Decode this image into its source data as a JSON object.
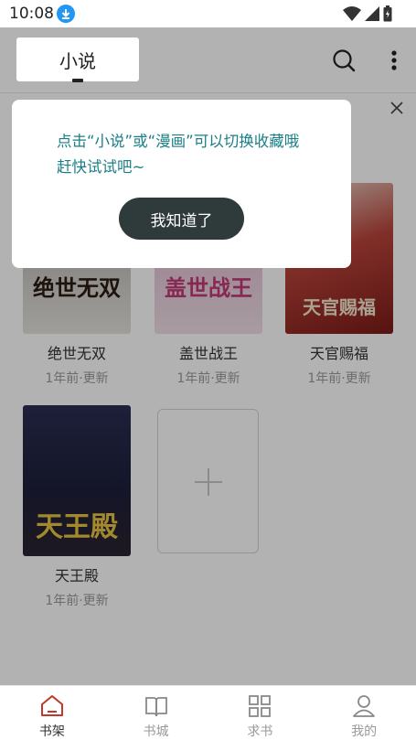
{
  "status_bar": {
    "time": "10:08"
  },
  "header": {
    "active_tab": "小说"
  },
  "tooltip": {
    "line1": "点击“小说”或“漫画”可以切换收藏哦",
    "line2": "赶快试试吧~",
    "button": "我知道了"
  },
  "books": [
    {
      "title": "绝世无双",
      "update": "1年前·更新",
      "cover_text": "绝世无双"
    },
    {
      "title": "盖世战王",
      "update": "1年前·更新",
      "cover_text": "盖世战王"
    },
    {
      "title": "天官赐福",
      "update": "1年前·更新",
      "cover_text": "天官赐福"
    },
    {
      "title": "天王殿",
      "update": "1年前·更新",
      "cover_text": "天王殿"
    }
  ],
  "nav": [
    {
      "label": "书架",
      "icon": "home-icon",
      "active": true
    },
    {
      "label": "书城",
      "icon": "book-open-icon",
      "active": false
    },
    {
      "label": "求书",
      "icon": "grid-icon",
      "active": false
    },
    {
      "label": "我的",
      "icon": "user-icon",
      "active": false
    }
  ],
  "colors": {
    "accent": "#c0392b",
    "tip_text": "#1a7f86",
    "button_bg": "#2f3b3a"
  }
}
